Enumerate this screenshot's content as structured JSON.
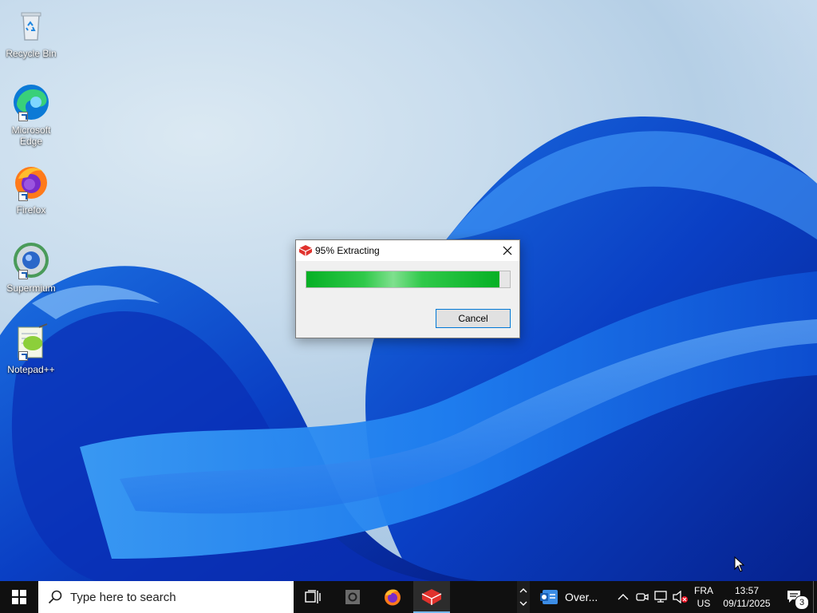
{
  "desktop": {
    "icons": [
      {
        "label": "Recycle Bin",
        "icon": "recycle-bin-icon"
      },
      {
        "label": "Microsoft Edge",
        "icon": "edge-icon"
      },
      {
        "label": "Firefox",
        "icon": "firefox-icon"
      },
      {
        "label": "Supermium",
        "icon": "supermium-icon"
      },
      {
        "label": "Notepad++",
        "icon": "notepadpp-icon"
      }
    ]
  },
  "dialog": {
    "title": "95% Extracting",
    "progress_percent": 95,
    "cancel_label": "Cancel",
    "accent": "#06b025"
  },
  "taskbar": {
    "search_placeholder": "Type here to search",
    "widget_label": "Over...",
    "language": "FRA",
    "region": "US",
    "time": "13:57",
    "date": "09/11/2025",
    "notification_count": "3"
  },
  "colors": {
    "taskbar_bg": "#101010",
    "running_indicator": "#76b9ed",
    "focus_border": "#0078d7"
  }
}
